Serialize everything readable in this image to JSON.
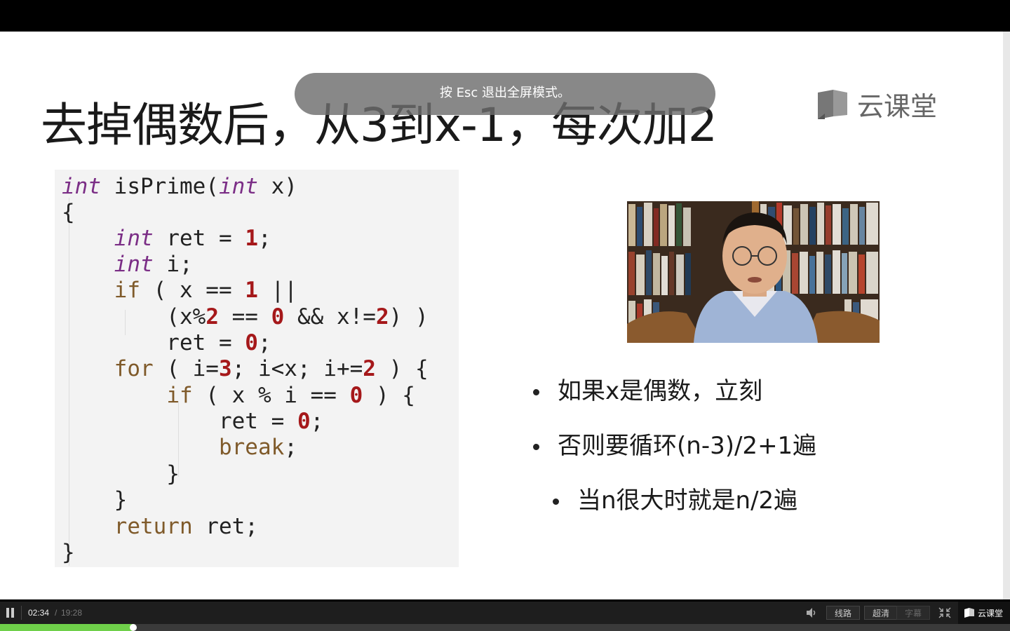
{
  "slide": {
    "title": "去掉偶数后，从3到x-1，每次加2",
    "logo_text": "云课堂",
    "esc_hint": "按 Esc 退出全屏模式。",
    "bullets": [
      "如果x是偶数，立刻",
      "否则要循环(n-3)/2+1遍",
      "当n很大时就是n/2遍"
    ]
  },
  "code": {
    "lines": [
      [
        {
          "t": "int",
          "c": "kw"
        },
        {
          "t": " isPrime(",
          "c": ""
        },
        {
          "t": "int",
          "c": "kw"
        },
        {
          "t": " x)",
          "c": ""
        }
      ],
      [
        {
          "t": "{",
          "c": ""
        }
      ],
      [
        {
          "t": "    ",
          "c": ""
        },
        {
          "t": "int",
          "c": "kw"
        },
        {
          "t": " ret = ",
          "c": ""
        },
        {
          "t": "1",
          "c": "num"
        },
        {
          "t": ";",
          "c": ""
        }
      ],
      [
        {
          "t": "    ",
          "c": ""
        },
        {
          "t": "int",
          "c": "kw"
        },
        {
          "t": " i;",
          "c": ""
        }
      ],
      [
        {
          "t": "    ",
          "c": ""
        },
        {
          "t": "if",
          "c": "k2"
        },
        {
          "t": " ( x == ",
          "c": ""
        },
        {
          "t": "1",
          "c": "num"
        },
        {
          "t": " ||",
          "c": ""
        }
      ],
      [
        {
          "t": "        (x%",
          "c": ""
        },
        {
          "t": "2",
          "c": "num"
        },
        {
          "t": " == ",
          "c": ""
        },
        {
          "t": "0",
          "c": "num"
        },
        {
          "t": " && x!=",
          "c": ""
        },
        {
          "t": "2",
          "c": "num"
        },
        {
          "t": ") )",
          "c": ""
        }
      ],
      [
        {
          "t": "        ret = ",
          "c": ""
        },
        {
          "t": "0",
          "c": "num"
        },
        {
          "t": ";",
          "c": ""
        }
      ],
      [
        {
          "t": "    ",
          "c": ""
        },
        {
          "t": "for",
          "c": "k2"
        },
        {
          "t": " ( i=",
          "c": ""
        },
        {
          "t": "3",
          "c": "num"
        },
        {
          "t": "; i<x; i+=",
          "c": ""
        },
        {
          "t": "2",
          "c": "num"
        },
        {
          "t": " ) {",
          "c": ""
        }
      ],
      [
        {
          "t": "        ",
          "c": ""
        },
        {
          "t": "if",
          "c": "k2"
        },
        {
          "t": " ( x % i == ",
          "c": ""
        },
        {
          "t": "0",
          "c": "num"
        },
        {
          "t": " ) {",
          "c": ""
        }
      ],
      [
        {
          "t": "            ret = ",
          "c": ""
        },
        {
          "t": "0",
          "c": "num"
        },
        {
          "t": ";",
          "c": ""
        }
      ],
      [
        {
          "t": "            ",
          "c": ""
        },
        {
          "t": "break",
          "c": "k2"
        },
        {
          "t": ";",
          "c": ""
        }
      ],
      [
        {
          "t": "        }",
          "c": ""
        }
      ],
      [
        {
          "t": "    }",
          "c": ""
        }
      ],
      [
        {
          "t": "    ",
          "c": ""
        },
        {
          "t": "return",
          "c": "k2"
        },
        {
          "t": " ret;",
          "c": ""
        }
      ],
      [
        {
          "t": "}",
          "c": ""
        }
      ]
    ]
  },
  "player": {
    "current_time": "02:34",
    "separator": "/",
    "duration": "19:28",
    "progress_fraction": 0.132,
    "route_label": "线路",
    "quality_label": "超清",
    "subtitle_label": "字幕",
    "brand_label": "云课堂",
    "icons": [
      "pause-icon",
      "volume-icon",
      "fullscreen-exit-icon",
      "cloud-classroom-logo-icon"
    ]
  },
  "colors": {
    "keyword_italic": "#7b2e86",
    "keyword": "#7f5a2a",
    "number": "#a5181a",
    "progress": "#6fd04a"
  }
}
